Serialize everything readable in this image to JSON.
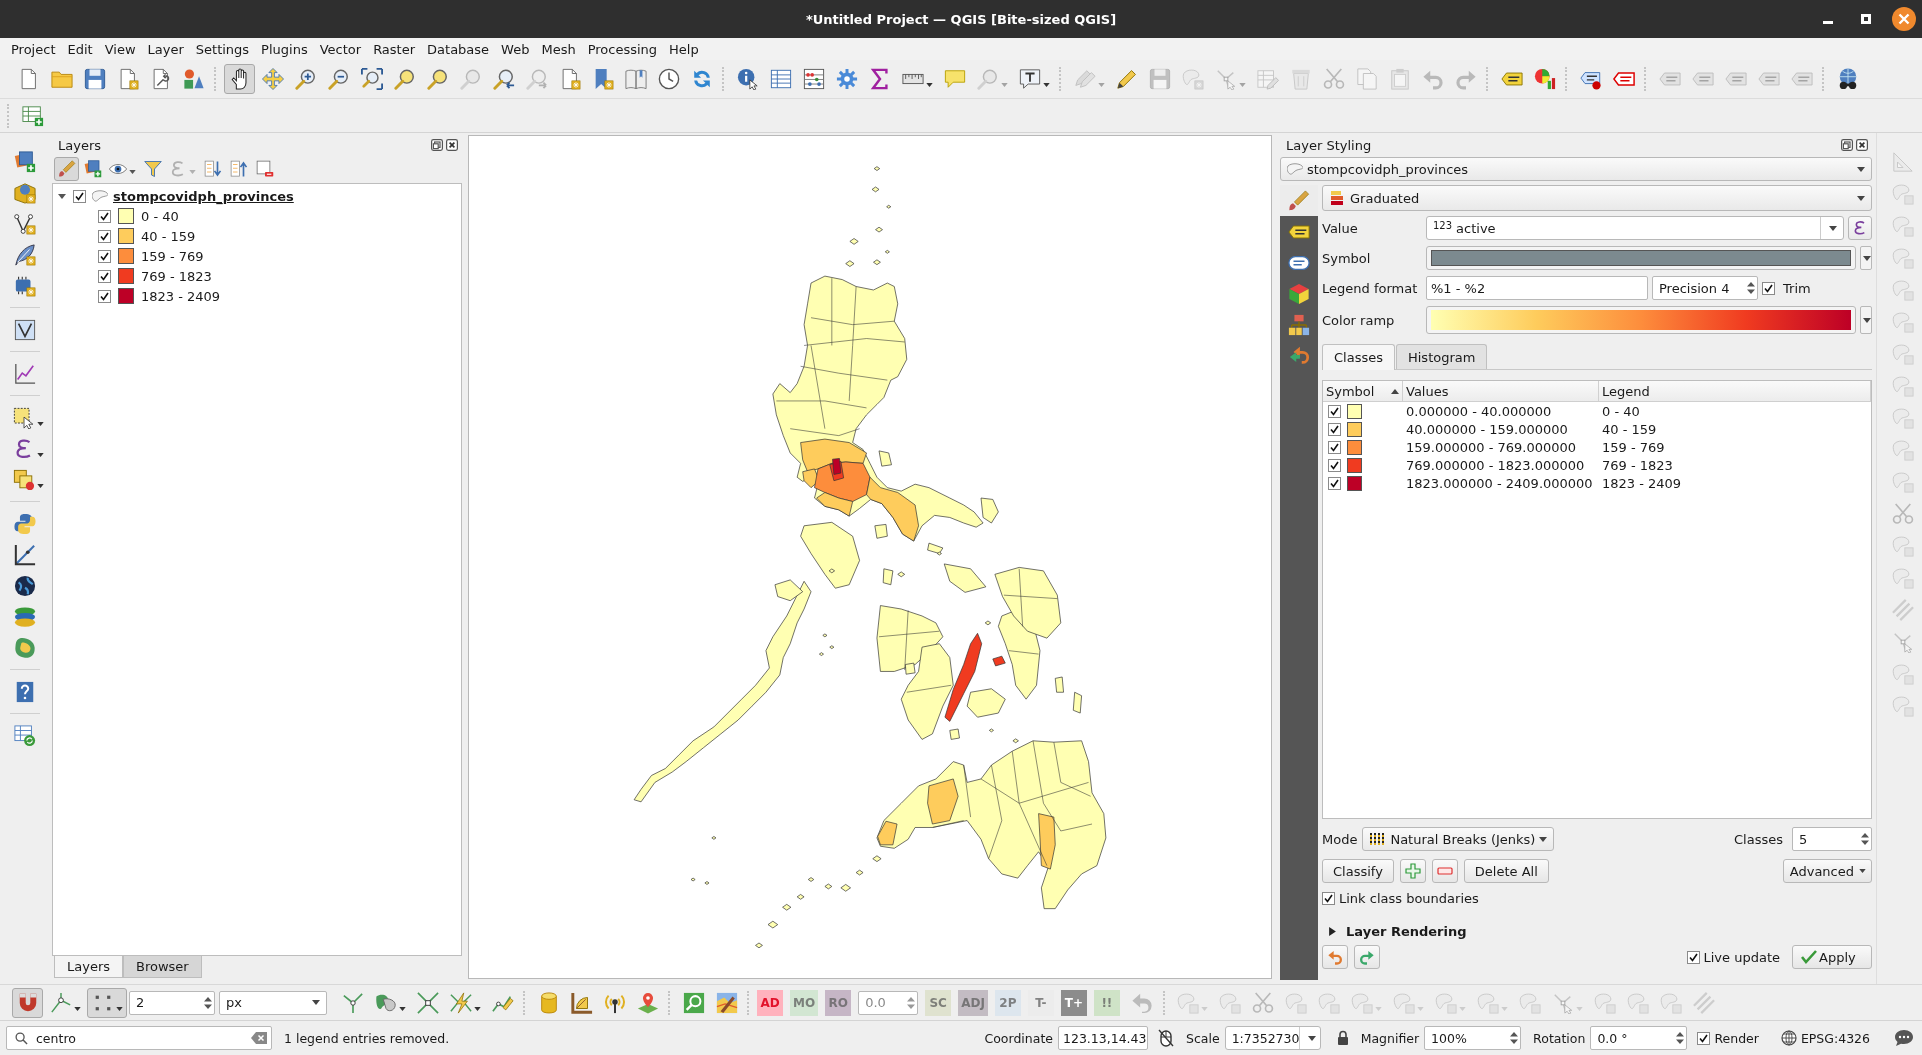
{
  "window": {
    "title": "*Untitled Project — QGIS [Bite-sized QGIS]"
  },
  "menu_bar": [
    "Project",
    "Edit",
    "View",
    "Layer",
    "Settings",
    "Plugins",
    "Vector",
    "Raster",
    "Database",
    "Web",
    "Mesh",
    "Processing",
    "Help"
  ],
  "toolbars": {
    "main": [
      {
        "selected": false,
        "disabled": false
      },
      {
        "selected": false,
        "disabled": false
      },
      {
        "selected": false,
        "disabled": false
      },
      {
        "selected": false,
        "disabled": false
      },
      {
        "selected": false,
        "disabled": false
      },
      {
        "selected": false,
        "disabled": false
      },
      {
        "selected": true,
        "disabled": false
      },
      {
        "selected": false,
        "disabled": false
      },
      {
        "selected": false,
        "disabled": false
      },
      {
        "selected": false,
        "disabled": false
      },
      {
        "selected": false,
        "disabled": false
      },
      {
        "selected": false,
        "disabled": false
      },
      {
        "selected": false,
        "disabled": false
      },
      {
        "selected": false,
        "disabled": true
      },
      {
        "selected": false,
        "disabled": false
      },
      {
        "selected": false,
        "disabled": true
      },
      {
        "selected": false,
        "disabled": false
      },
      {
        "selected": false,
        "disabled": false
      },
      {
        "selected": false,
        "disabled": false
      },
      {
        "selected": false,
        "disabled": false
      },
      {
        "selected": false,
        "disabled": false
      },
      {
        "selected": false,
        "disabled": false
      },
      {
        "selected": false,
        "disabled": false
      },
      {
        "selected": false,
        "disabled": false
      },
      {
        "selected": false,
        "disabled": false
      },
      {
        "selected": false,
        "disabled": false
      },
      {
        "selected": false,
        "disabled": false
      },
      {
        "selected": false,
        "disabled": false
      },
      {
        "selected": false,
        "disabled": true
      },
      {
        "selected": false,
        "disabled": false
      },
      {
        "selected": false,
        "disabled": true
      },
      {
        "selected": false,
        "disabled": false
      },
      {
        "selected": false,
        "disabled": true
      },
      {
        "selected": false,
        "disabled": true
      },
      {
        "selected": false,
        "disabled": true
      },
      {
        "selected": false,
        "disabled": true
      },
      {
        "selected": false,
        "disabled": true
      },
      {
        "selected": false,
        "disabled": true
      },
      {
        "selected": false,
        "disabled": true
      },
      {
        "selected": false,
        "disabled": true
      },
      {
        "selected": false,
        "disabled": true
      },
      {
        "selected": false,
        "disabled": true
      },
      {
        "selected": false,
        "disabled": false
      },
      {
        "selected": false,
        "disabled": false
      },
      {
        "selected": false,
        "disabled": false
      },
      {
        "selected": false,
        "disabled": false
      },
      {
        "selected": false,
        "disabled": true
      },
      {
        "selected": false,
        "disabled": true
      },
      {
        "selected": false,
        "disabled": true
      },
      {
        "selected": false,
        "disabled": true
      },
      {
        "selected": false,
        "disabled": true
      },
      {
        "selected": false,
        "disabled": false
      }
    ],
    "secondary": [
      {
        "selected": false,
        "disabled": false
      }
    ],
    "left": [
      {
        "selected": false,
        "disabled": false
      },
      {
        "selected": false,
        "disabled": false
      },
      {
        "selected": false,
        "disabled": false
      },
      {
        "selected": false,
        "disabled": false
      },
      {
        "selected": false,
        "disabled": false
      },
      {
        "selected": false,
        "disabled": false
      },
      {
        "selected": false,
        "disabled": false
      },
      {
        "selected": false,
        "disabled": false
      },
      {
        "selected": false,
        "disabled": false
      },
      {
        "selected": false,
        "disabled": false
      },
      {
        "selected": false,
        "disabled": false
      },
      {
        "selected": false,
        "disabled": false
      },
      {
        "selected": false,
        "disabled": false
      },
      {
        "selected": false,
        "disabled": false
      },
      {
        "selected": false,
        "disabled": false
      },
      {
        "selected": false,
        "disabled": false
      },
      {
        "selected": false,
        "disabled": false
      }
    ],
    "right": [
      {
        "selected": false,
        "disabled": true
      },
      {
        "selected": false,
        "disabled": true
      },
      {
        "selected": false,
        "disabled": true
      },
      {
        "selected": false,
        "disabled": true
      },
      {
        "selected": false,
        "disabled": true
      },
      {
        "selected": false,
        "disabled": true
      },
      {
        "selected": false,
        "disabled": true
      },
      {
        "selected": false,
        "disabled": true
      },
      {
        "selected": false,
        "disabled": true
      },
      {
        "selected": false,
        "disabled": true
      },
      {
        "selected": false,
        "disabled": true
      },
      {
        "selected": false,
        "disabled": true
      },
      {
        "selected": false,
        "disabled": true
      },
      {
        "selected": false,
        "disabled": true
      },
      {
        "selected": false,
        "disabled": true
      },
      {
        "selected": false,
        "disabled": true
      },
      {
        "selected": false,
        "disabled": true
      },
      {
        "selected": false,
        "disabled": true
      }
    ]
  },
  "layers_panel": {
    "title": "Layers",
    "toolbar": [
      {
        "selected": true,
        "disabled": false
      },
      {
        "selected": false,
        "disabled": false
      },
      {
        "selected": false,
        "disabled": false
      },
      {
        "selected": false,
        "disabled": false
      },
      {
        "selected": false,
        "disabled": true
      },
      {
        "selected": false,
        "disabled": false
      },
      {
        "selected": false,
        "disabled": false
      },
      {
        "selected": false,
        "disabled": false
      }
    ],
    "layers": [
      {
        "name": "stompcovidph_provinces",
        "checked": true,
        "expanded": true,
        "children": [
          {
            "label": "0 - 40",
            "checked": true,
            "color": "#ffffb2"
          },
          {
            "label": "40 - 159",
            "checked": true,
            "color": "#fecc5c"
          },
          {
            "label": "159 - 769",
            "checked": true,
            "color": "#fd8d3c"
          },
          {
            "label": "769 - 1823",
            "checked": true,
            "color": "#f03b20"
          },
          {
            "label": "1823 - 2409",
            "checked": true,
            "color": "#bd0026"
          }
        ]
      }
    ],
    "tabs": [
      {
        "label": "Layers",
        "selected": true
      },
      {
        "label": "Browser",
        "selected": false
      }
    ]
  },
  "layer_styling": {
    "title": "Layer Styling",
    "layer": "stompcovidph_provinces",
    "side_tabs": [
      {
        "selected": true
      },
      {
        "selected": false
      },
      {
        "selected": false
      },
      {
        "selected": false
      },
      {
        "selected": false
      },
      {
        "selected": false
      }
    ],
    "renderer": "Graduated",
    "value_label": "Value",
    "value_type": "123",
    "value": "active",
    "symbol_label": "Symbol",
    "legend_format_label": "Legend format",
    "legend_format": "%1 - %2",
    "precision": "Precision 4",
    "trim": {
      "label": "Trim",
      "checked": true
    },
    "color_ramp_label": "Color ramp",
    "tabs": [
      {
        "label": "Classes",
        "selected": true
      },
      {
        "label": "Histogram",
        "selected": false
      }
    ],
    "columns": [
      {
        "label": "Symbol",
        "sorted": true
      },
      {
        "label": "Values",
        "sorted": false
      },
      {
        "label": "Legend",
        "sorted": false
      }
    ],
    "classes": [
      {
        "checked": true,
        "color": "#ffffb2",
        "values": "0.000000 - 40.000000",
        "legend": "0 - 40"
      },
      {
        "checked": true,
        "color": "#fecc5c",
        "values": "40.000000 - 159.000000",
        "legend": "40 - 159"
      },
      {
        "checked": true,
        "color": "#fd8d3c",
        "values": "159.000000 - 769.000000",
        "legend": "159 - 769"
      },
      {
        "checked": true,
        "color": "#f03b20",
        "values": "769.000000 - 1823.000000",
        "legend": "769 - 1823"
      },
      {
        "checked": true,
        "color": "#bd0026",
        "values": "1823.000000 - 2409.000000",
        "legend": "1823 - 2409"
      }
    ],
    "mode_label": "Mode",
    "mode": "Natural Breaks (Jenks)",
    "classes_label": "Classes",
    "class_count": "5",
    "classify": "Classify",
    "delete_all": "Delete All",
    "advanced": "Advanced",
    "link_boundaries": {
      "label": "Link class boundaries",
      "checked": true
    },
    "layer_rendering": {
      "label": "Layer Rendering",
      "expanded": false
    },
    "live_update": {
      "label": "Live update",
      "checked": true
    },
    "apply": "Apply"
  },
  "bottom_toolbar": {
    "snapping": [
      {
        "selected": true,
        "disabled": false
      },
      {
        "selected": false,
        "disabled": false
      },
      {
        "selected": true,
        "disabled": false
      }
    ],
    "tolerance": "2",
    "units": "px",
    "snapping_options": [
      {
        "selected": false,
        "disabled": false
      },
      {
        "selected": false,
        "disabled": false
      },
      {
        "selected": false,
        "disabled": false
      },
      {
        "selected": false,
        "disabled": false
      },
      {
        "selected": false,
        "disabled": false
      }
    ],
    "tools": [
      {
        "selected": false,
        "disabled": false
      },
      {
        "selected": false,
        "disabled": false
      },
      {
        "selected": false,
        "disabled": false
      },
      {
        "selected": false,
        "disabled": false
      },
      {
        "selected": false,
        "disabled": false
      },
      {
        "selected": false,
        "disabled": false
      }
    ],
    "label_tools": [
      {
        "kind": "tile",
        "label": "AD",
        "color": "#ffb2bd",
        "disabled": false
      },
      {
        "kind": "tile",
        "label": "MO",
        "color": "#d2e6d2",
        "disabled": true
      },
      {
        "kind": "tile",
        "label": "RO",
        "color": "#c6b6c6",
        "disabled": true
      },
      {
        "kind": "spin",
        "value": "0.0",
        "disabled": true
      },
      {
        "kind": "tile",
        "label": "SC",
        "color": "#dfe2cf",
        "disabled": true
      },
      {
        "kind": "tile",
        "label": "ADJ",
        "color": "#c3bcc3",
        "disabled": true
      },
      {
        "kind": "tile",
        "label": "2P",
        "color": "#dde6ee",
        "disabled": true
      },
      {
        "kind": "tile",
        "label": "T-",
        "color": "#ececec",
        "disabled": true
      },
      {
        "kind": "tile",
        "label": "T+",
        "color": "#8c8c8c",
        "disabled": false
      },
      {
        "kind": "tile",
        "label": "!!",
        "color": "#cfe3c7",
        "disabled": true
      },
      {
        "kind": "icon",
        "disabled": true
      }
    ],
    "digitizing": [
      {
        "selected": false,
        "disabled": true
      },
      {
        "selected": false,
        "disabled": true
      },
      {
        "selected": false,
        "disabled": true
      },
      {
        "selected": false,
        "disabled": true
      },
      {
        "selected": false,
        "disabled": true
      },
      {
        "selected": false,
        "disabled": true
      },
      {
        "selected": false,
        "disabled": true
      },
      {
        "selected": false,
        "disabled": true
      },
      {
        "selected": false,
        "disabled": true
      },
      {
        "selected": false,
        "disabled": true
      },
      {
        "selected": false,
        "disabled": true
      },
      {
        "selected": false,
        "disabled": true
      },
      {
        "selected": false,
        "disabled": true
      },
      {
        "selected": false,
        "disabled": true
      },
      {
        "selected": false,
        "disabled": true
      }
    ]
  },
  "status_bar": {
    "search": "centro",
    "message": "1 legend entries removed.",
    "coordinate_label": "Coordinate",
    "coordinate": "123.13,14.43",
    "scale_label": "Scale",
    "scale": "1:7352730",
    "magnifier_label": "Magnifier",
    "magnifier": "100%",
    "rotation_label": "Rotation",
    "rotation": "0.0 °",
    "render": {
      "label": "Render",
      "checked": true
    },
    "crs": "EPSG:4326"
  }
}
